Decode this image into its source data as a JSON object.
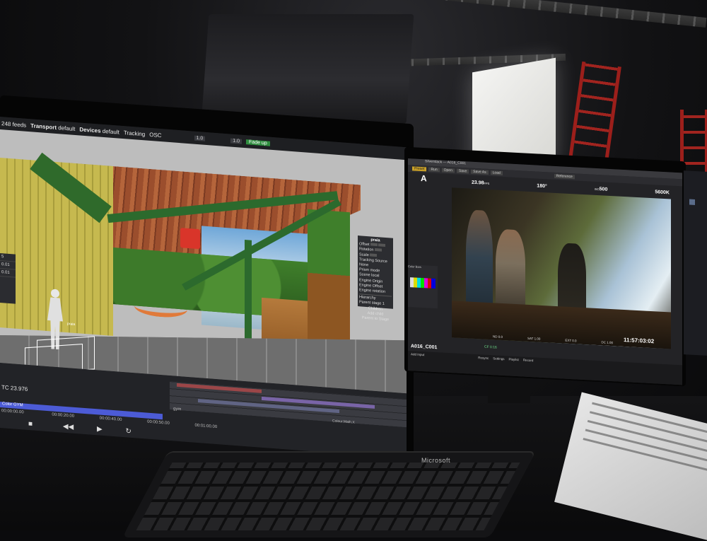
{
  "left_monitor": {
    "menubar": {
      "feeds": "248 feeds",
      "transport": "Transport",
      "transport_value": "default",
      "devices": "Devices",
      "devices_value": "default",
      "tracking": "Tracking",
      "osc": "OSC",
      "field1": "1.0",
      "field2": "1.0",
      "fade_button": "Fade up"
    },
    "side_panel": [
      "5",
      "0.01",
      "0.01"
    ],
    "properties_panel": {
      "title": "praia",
      "rows": [
        "Offset",
        "Rotation",
        "Scale",
        "Tracking Source",
        "Prism mode",
        "Engine Origin",
        "Engine Offset",
        "Engine rotation",
        "Hierarchy",
        "Parent"
      ],
      "right_values": [
        "None",
        "Scene local",
        "stage 1"
      ],
      "actions": [
        "Children",
        "Add child",
        "Parent to Stage"
      ]
    },
    "viewport_label": "praia",
    "timeline": {
      "timecode": "TC 23.976",
      "clip_bar": "Color GYM",
      "ticks": [
        "00:00:00.00",
        "00:00:20.00",
        "00:00:40.00",
        "00:00:50.00",
        "00:01:00.00"
      ],
      "side_label": "Colour.Math.X",
      "track_label": "gym"
    }
  },
  "right_monitor": {
    "titlebar": "Silverstack — A016_C001",
    "toolbar": [
      "Preset",
      "Run",
      "Open",
      "Save",
      "Save As",
      "Load"
    ],
    "reference_label": "Reference",
    "camera": {
      "letter": "A",
      "fps": "23.98",
      "fps_unit": "FPS",
      "shutter": "180°",
      "iso_label": "ISO",
      "iso": "500",
      "white_balance": "5600K"
    },
    "video_timecode": "11:57:03:02",
    "video_meta": [
      "ND 0.0",
      "SAT 1.00",
      "EXT 0.0",
      "DC 1.00"
    ],
    "clip_name": "A016_C001",
    "cf_label": "CF 0:16",
    "strip_items": [
      "Add Input",
      "Resync",
      "Settings",
      "Playlist",
      "Record"
    ],
    "side_label": "Color Bars"
  },
  "keyboard_brand": "Microsoft",
  "colors": {
    "fade_button": "#2f8d3e",
    "timeline_bar": "#4c5bd6",
    "toolbar_active": "#c9a028",
    "ladder": "#a1241f"
  }
}
